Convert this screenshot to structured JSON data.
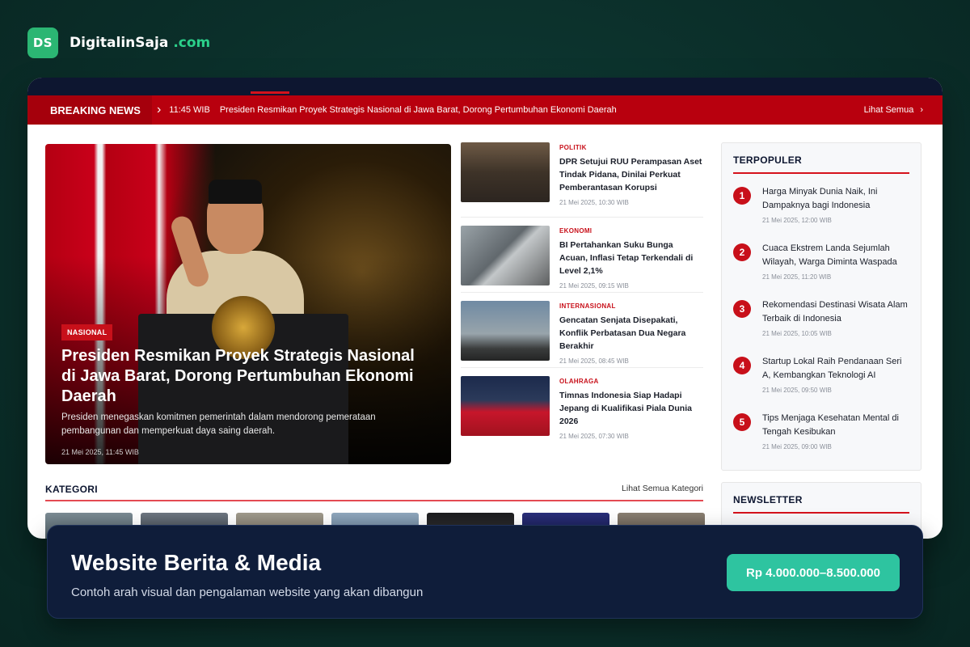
{
  "brand": {
    "mark": "DS",
    "name": "DigitalinSaja",
    "tld": ".com"
  },
  "site": {
    "breaking": {
      "label": "BREAKING NEWS",
      "time": "11:45 WIB",
      "text": "Presiden Resmikan Proyek Strategis Nasional di Jawa Barat, Dorong Pertumbuhan Ekonomi Daerah",
      "see_all": "Lihat Semua"
    },
    "hero": {
      "tag": "NASIONAL",
      "title": "Presiden Resmikan Proyek Strategis Nasional di Jawa Barat, Dorong Pertumbuhan Ekonomi Daerah",
      "desc": "Presiden menegaskan komitmen pemerintah dalam mendorong pemerataan pembangunan dan memperkuat daya saing daerah.",
      "date": "21 Mei 2025, 11:45 WIB"
    },
    "articles": [
      {
        "category": "POLITIK",
        "title": "DPR Setujui RUU Perampasan Aset Tindak Pidana, Dinilai Perkuat Pemberantasan Korupsi",
        "date": "21 Mei 2025, 10:30 WIB"
      },
      {
        "category": "EKONOMI",
        "title": "BI Pertahankan Suku Bunga Acuan, Inflasi Tetap Terkendali di Level 2,1%",
        "date": "21 Mei 2025, 09:15 WIB"
      },
      {
        "category": "INTERNASIONAL",
        "title": "Gencatan Senjata Disepakati, Konflik Perbatasan Dua Negara Berakhir",
        "date": "21 Mei 2025, 08:45 WIB"
      },
      {
        "category": "OLAHRAGA",
        "title": "Timnas Indonesia Siap Hadapi Jepang di Kualifikasi Piala Dunia 2026",
        "date": "21 Mei 2025, 07:30 WIB"
      }
    ],
    "popular": {
      "title": "TERPOPULER",
      "items": [
        {
          "num": "1",
          "title": "Harga Minyak Dunia Naik, Ini Dampaknya bagi Indonesia",
          "date": "21 Mei 2025, 12:00 WIB"
        },
        {
          "num": "2",
          "title": "Cuaca Ekstrem Landa Sejumlah Wilayah, Warga Diminta Waspada",
          "date": "21 Mei 2025, 11:20 WIB"
        },
        {
          "num": "3",
          "title": "Rekomendasi Destinasi Wisata Alam Terbaik di Indonesia",
          "date": "21 Mei 2025, 10:05 WIB"
        },
        {
          "num": "4",
          "title": "Startup Lokal Raih Pendanaan Seri A, Kembangkan Teknologi AI",
          "date": "21 Mei 2025, 09:50 WIB"
        },
        {
          "num": "5",
          "title": "Tips Menjaga Kesehatan Mental di Tengah Kesibukan",
          "date": "21 Mei 2025, 09:00 WIB"
        }
      ]
    },
    "newsletter": {
      "title": "NEWSLETTER"
    },
    "categories": {
      "title": "KATEGORI",
      "see_all": "Lihat Semua Kategori"
    }
  },
  "banner": {
    "title": "Website Berita & Media",
    "subtitle": "Contoh arah visual dan pengalaman website yang akan dibangun",
    "price": "Rp 4.000.000–8.500.000"
  },
  "colors": {
    "accent_red": "#c8101a",
    "navy": "#0d1630",
    "teal_button": "#2ec4a0",
    "brand_green": "#2bb673"
  }
}
